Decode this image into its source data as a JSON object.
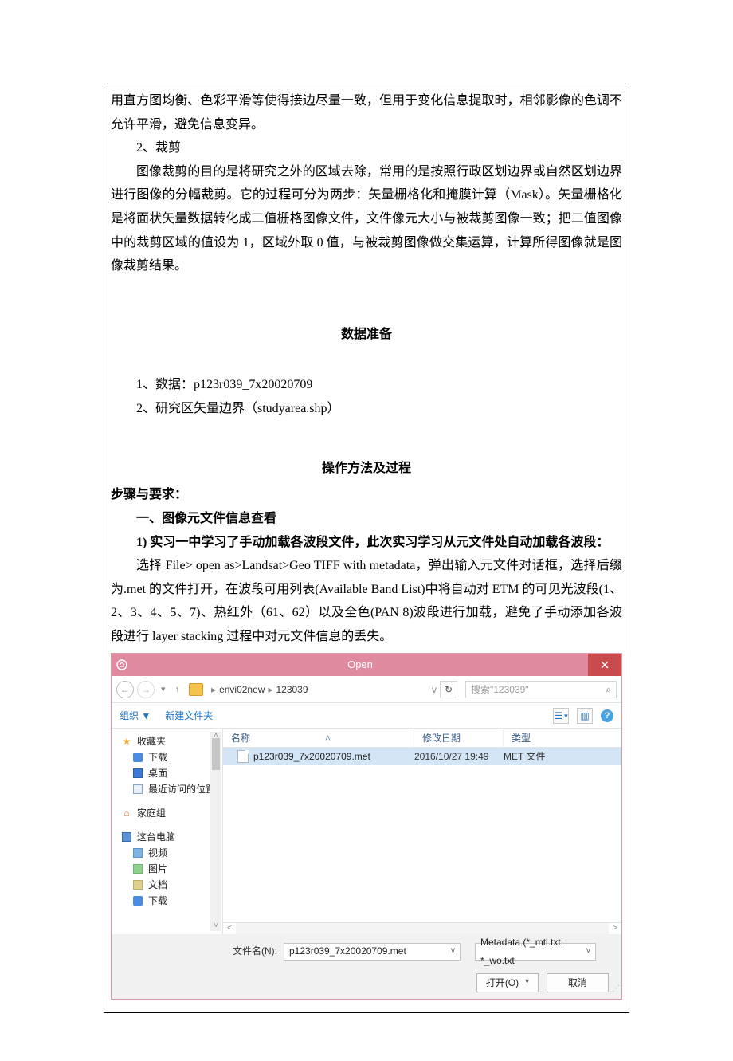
{
  "doc": {
    "p1": "用直方图均衡、色彩平滑等使得接边尽量一致，但用于变化信息提取时，相邻影像的色调不允许平滑，避免信息变异。",
    "p2_head": "2、裁剪",
    "p2": "图像裁剪的目的是将研究之外的区域去除，常用的是按照行政区划边界或自然区划边界进行图像的分幅裁剪。它的过程可分为两步：矢量栅格化和掩膜计算（Mask）。矢量栅格化是将面状矢量数据转化成二值栅格图像文件，文件像元大小与被裁剪图像一致；把二值图像中的裁剪区域的值设为 1，区域外取 0 值，与被裁剪图像做交集运算，计算所得图像就是图像裁剪结果。",
    "sec1": "数据准备",
    "d1": "1、数据：p123r039_7x20020709",
    "d2": "2、研究区矢量边界（studyarea.shp）",
    "sec2": "操作方法及过程",
    "step_head": "步骤与要求：",
    "step1": "一、图像元文件信息查看",
    "step1_1": "1) 实习一中学习了手动加载各波段文件，此次实习学习从元文件处自动加载各波段：",
    "p3": "选择 File> open as>Landsat>Geo TIFF with metadata，弹出输入元文件对话框，选择后缀为.met 的文件打开，在波段可用列表(Available Band List)中将自动对 ETM 的可见光波段(1、2、3、4、5、7)、热红外（61、62）以及全色(PAN 8)波段进行加载，避免了手动添加各波段进行 layer stacking 过程中对元文件信息的丢失。"
  },
  "dialog": {
    "title": "Open",
    "breadcrumb": {
      "a": "envi02new",
      "b": "123039"
    },
    "search_placeholder": "搜索\"123039\"",
    "toolbar": {
      "organize": "组织 ▼",
      "newfolder": "新建文件夹"
    },
    "sidebar": {
      "fav": "收藏夹",
      "downloads": "下载",
      "desktop": "桌面",
      "recent": "最近访问的位置",
      "homegroup": "家庭组",
      "thispc": "这台电脑",
      "videos": "视频",
      "pictures": "图片",
      "documents": "文档",
      "downloads2": "下载"
    },
    "cols": {
      "name": "名称",
      "date": "修改日期",
      "type": "类型"
    },
    "row": {
      "name": "p123r039_7x20020709.met",
      "date": "2016/10/27 19:49",
      "type": "MET 文件"
    },
    "footer": {
      "fn_label": "文件名(N):",
      "fn_value": "p123r039_7x20020709.met",
      "filter": "Metadata (*_mtl.txt; *_wo.txt",
      "open": "打开(O)",
      "cancel": "取消"
    }
  }
}
